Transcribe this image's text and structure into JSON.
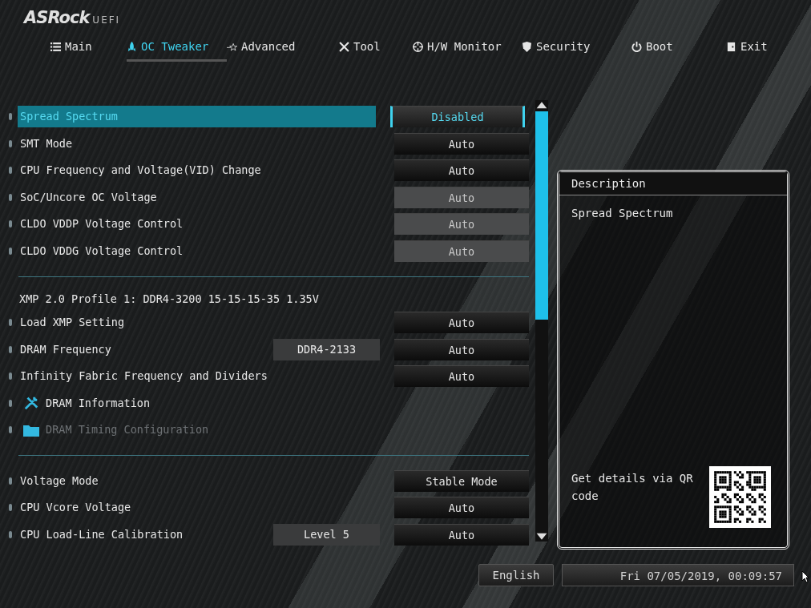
{
  "logo": {
    "brand": "ASRock",
    "sub": "UEFI"
  },
  "tabs": [
    {
      "label": "Main",
      "selected": false
    },
    {
      "label": "OC Tweaker",
      "selected": true
    },
    {
      "label": "Advanced",
      "selected": false
    },
    {
      "label": "Tool",
      "selected": false
    },
    {
      "label": "H/W Monitor",
      "selected": false
    },
    {
      "label": "Security",
      "selected": false
    },
    {
      "label": "Boot",
      "selected": false
    },
    {
      "label": "Exit",
      "selected": false
    }
  ],
  "settings": [
    {
      "kind": "setting",
      "label": "Spread Spectrum",
      "value": "Disabled",
      "selected": true,
      "locked": false
    },
    {
      "kind": "setting",
      "label": "SMT Mode",
      "value": "Auto",
      "selected": false,
      "locked": false
    },
    {
      "kind": "setting",
      "label": "CPU Frequency and Voltage(VID) Change",
      "value": "Auto",
      "selected": false,
      "locked": false
    },
    {
      "kind": "setting",
      "label": "SoC/Uncore OC Voltage",
      "value": "Auto",
      "selected": false,
      "locked": true
    },
    {
      "kind": "setting",
      "label": "CLDO VDDP Voltage Control",
      "value": "Auto",
      "selected": false,
      "locked": true
    },
    {
      "kind": "setting",
      "label": "CLDO VDDG Voltage Control",
      "value": "Auto",
      "selected": false,
      "locked": true
    },
    {
      "kind": "divider"
    },
    {
      "kind": "header",
      "label": "XMP 2.0 Profile 1: DDR4-3200 15-15-15-35 1.35V"
    },
    {
      "kind": "setting",
      "label": "Load XMP Setting",
      "value": "Auto",
      "selected": false,
      "locked": false
    },
    {
      "kind": "setting",
      "label": "DRAM Frequency",
      "reading": "DDR4-2133",
      "value": "Auto",
      "selected": false,
      "locked": false
    },
    {
      "kind": "setting",
      "label": "Infinity Fabric Frequency and Dividers",
      "value": "Auto",
      "selected": false,
      "locked": false
    },
    {
      "kind": "submenu",
      "label": "DRAM Information",
      "selected": false,
      "disabled": false
    },
    {
      "kind": "submenu",
      "label": "DRAM Timing Configuration",
      "selected": false,
      "disabled": true
    },
    {
      "kind": "divider"
    },
    {
      "kind": "setting",
      "label": "Voltage Mode",
      "value": "Stable Mode",
      "selected": false,
      "locked": false
    },
    {
      "kind": "setting",
      "label": "CPU Vcore Voltage",
      "value": "Auto",
      "selected": false,
      "locked": false
    },
    {
      "kind": "setting",
      "label": "CPU Load-Line Calibration",
      "reading": "Level 5",
      "value": "Auto",
      "selected": false,
      "locked": false
    }
  ],
  "description": {
    "title": "Description",
    "text": "Spread Spectrum",
    "qr_hint": "Get details via QR code"
  },
  "status_bar": {
    "language": "English",
    "datetime": "Fri 07/05/2019, 00:09:57"
  }
}
